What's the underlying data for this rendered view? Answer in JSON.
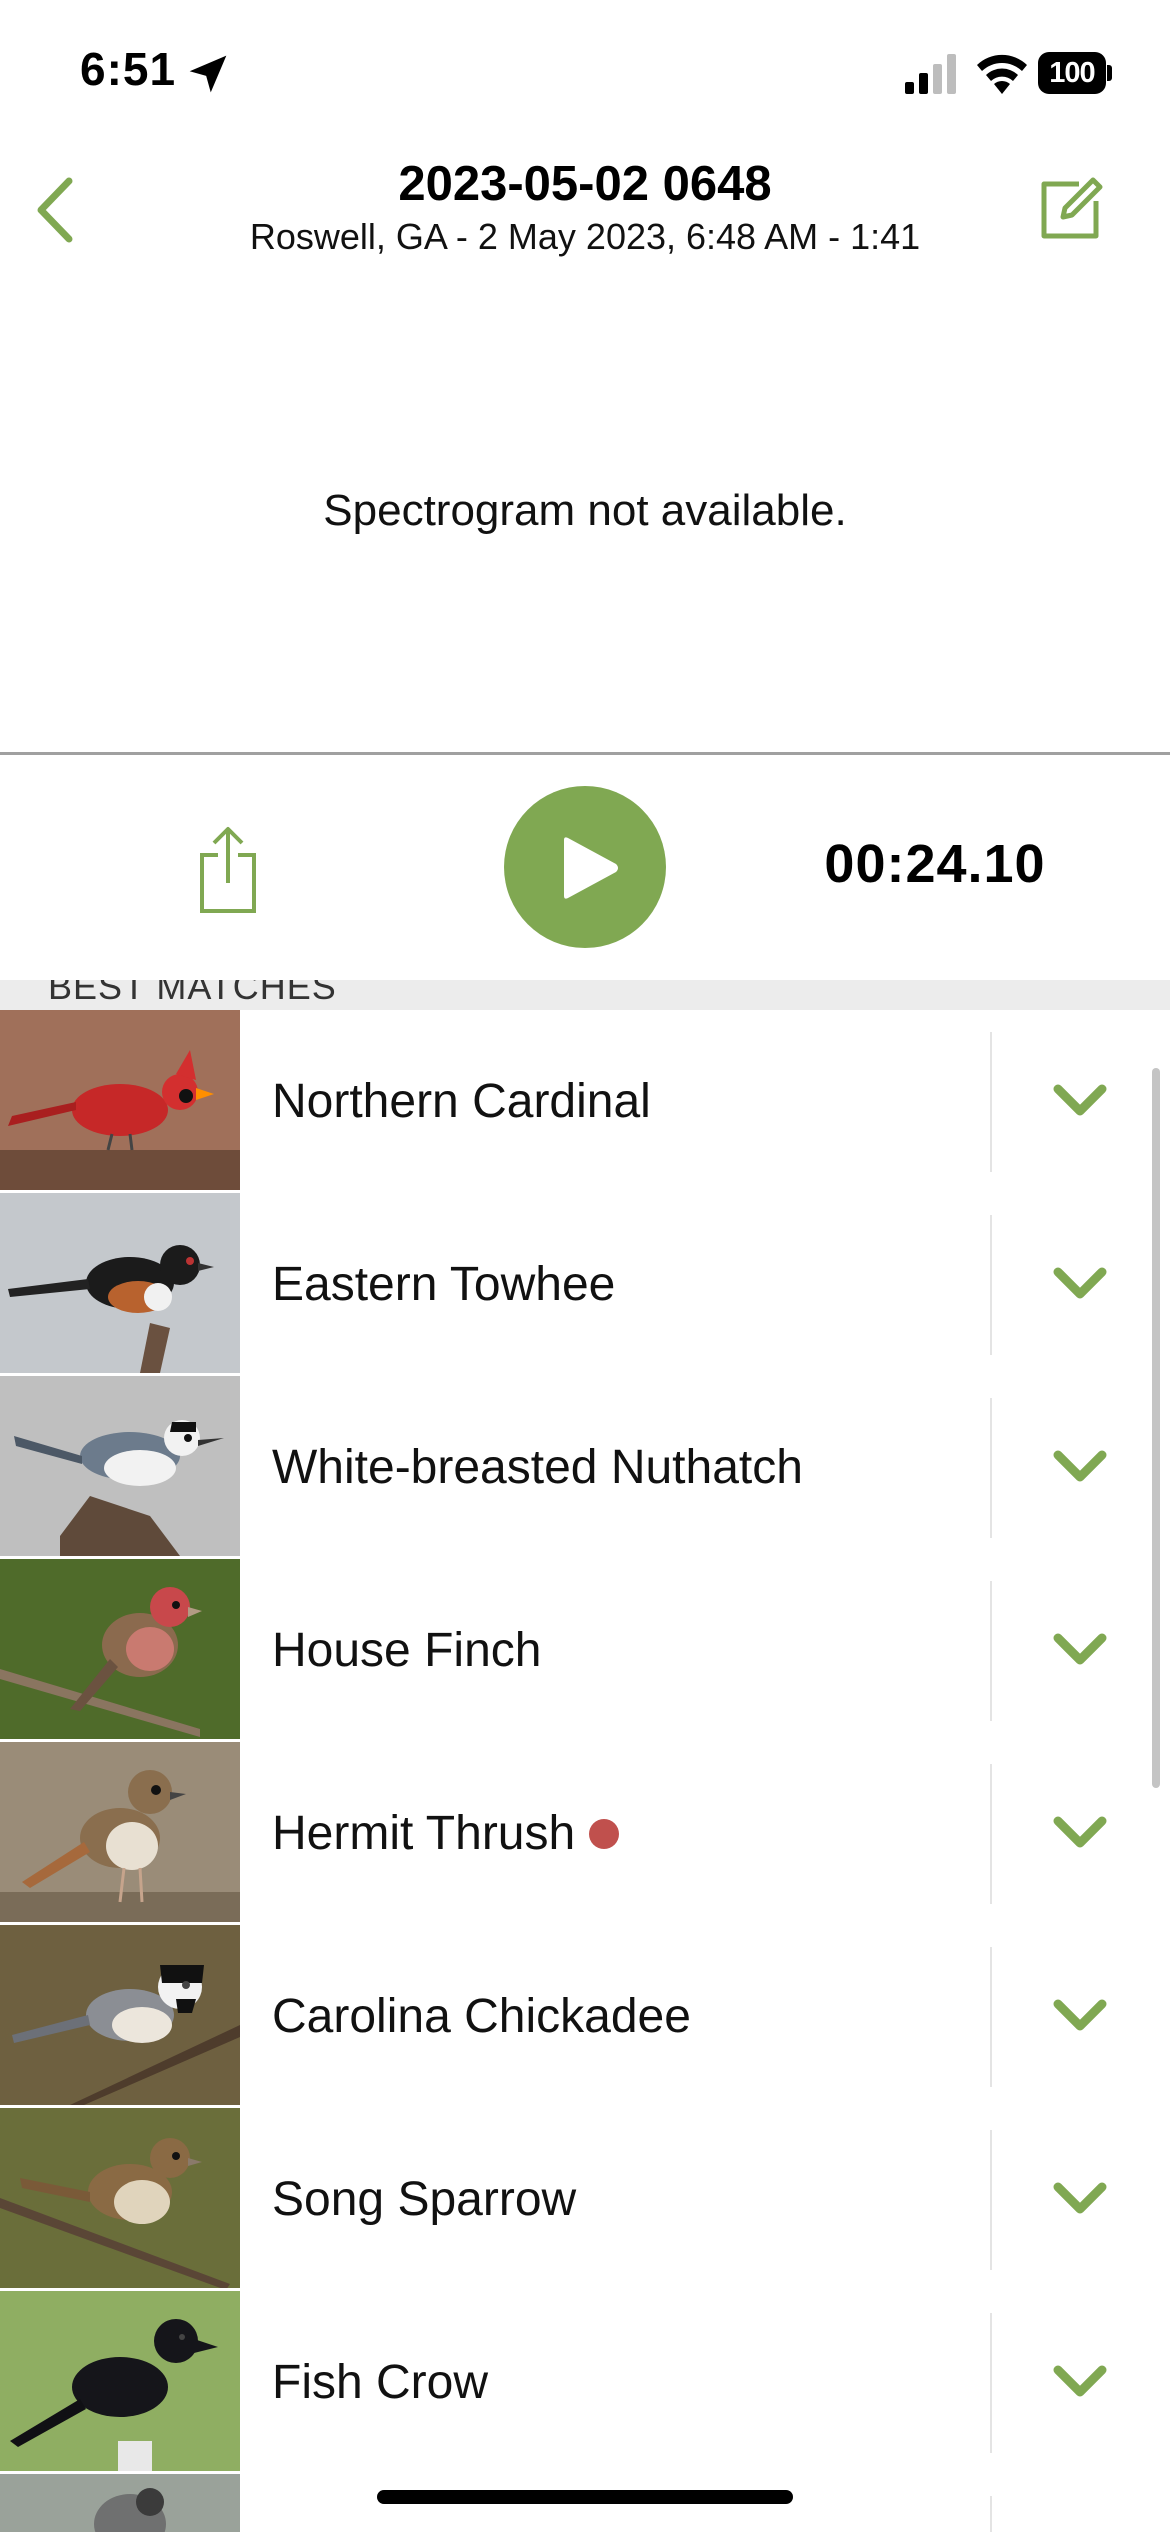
{
  "status_bar": {
    "time": "6:51",
    "battery": "100",
    "icons": [
      "location-arrow-icon",
      "signal-icon",
      "wifi-icon",
      "battery-icon"
    ]
  },
  "nav": {
    "title": "2023-05-02 0648",
    "subtitle": "Roswell, GA - 2 May 2023, 6:48 AM - 1:41",
    "back_icon": "chevron-left-icon",
    "edit_icon": "edit-icon"
  },
  "spectrogram": {
    "message": "Spectrogram not available."
  },
  "player": {
    "elapsed": "00:24.10",
    "share_icon": "share-icon",
    "play_icon": "play-icon"
  },
  "section": {
    "label": "BEST MATCHES"
  },
  "colors": {
    "accent": "#80a852",
    "new_dot": "#c0504d",
    "divider": "#a0a0a0"
  },
  "matches": [
    {
      "name": "Northern Cardinal",
      "new": false
    },
    {
      "name": "Eastern Towhee",
      "new": false
    },
    {
      "name": "White-breasted Nuthatch",
      "new": false
    },
    {
      "name": "House Finch",
      "new": false
    },
    {
      "name": "Hermit Thrush",
      "new": true
    },
    {
      "name": "Carolina Chickadee",
      "new": false
    },
    {
      "name": "Song Sparrow",
      "new": false
    },
    {
      "name": "Fish Crow",
      "new": false
    },
    {
      "name": "",
      "new": false
    }
  ]
}
